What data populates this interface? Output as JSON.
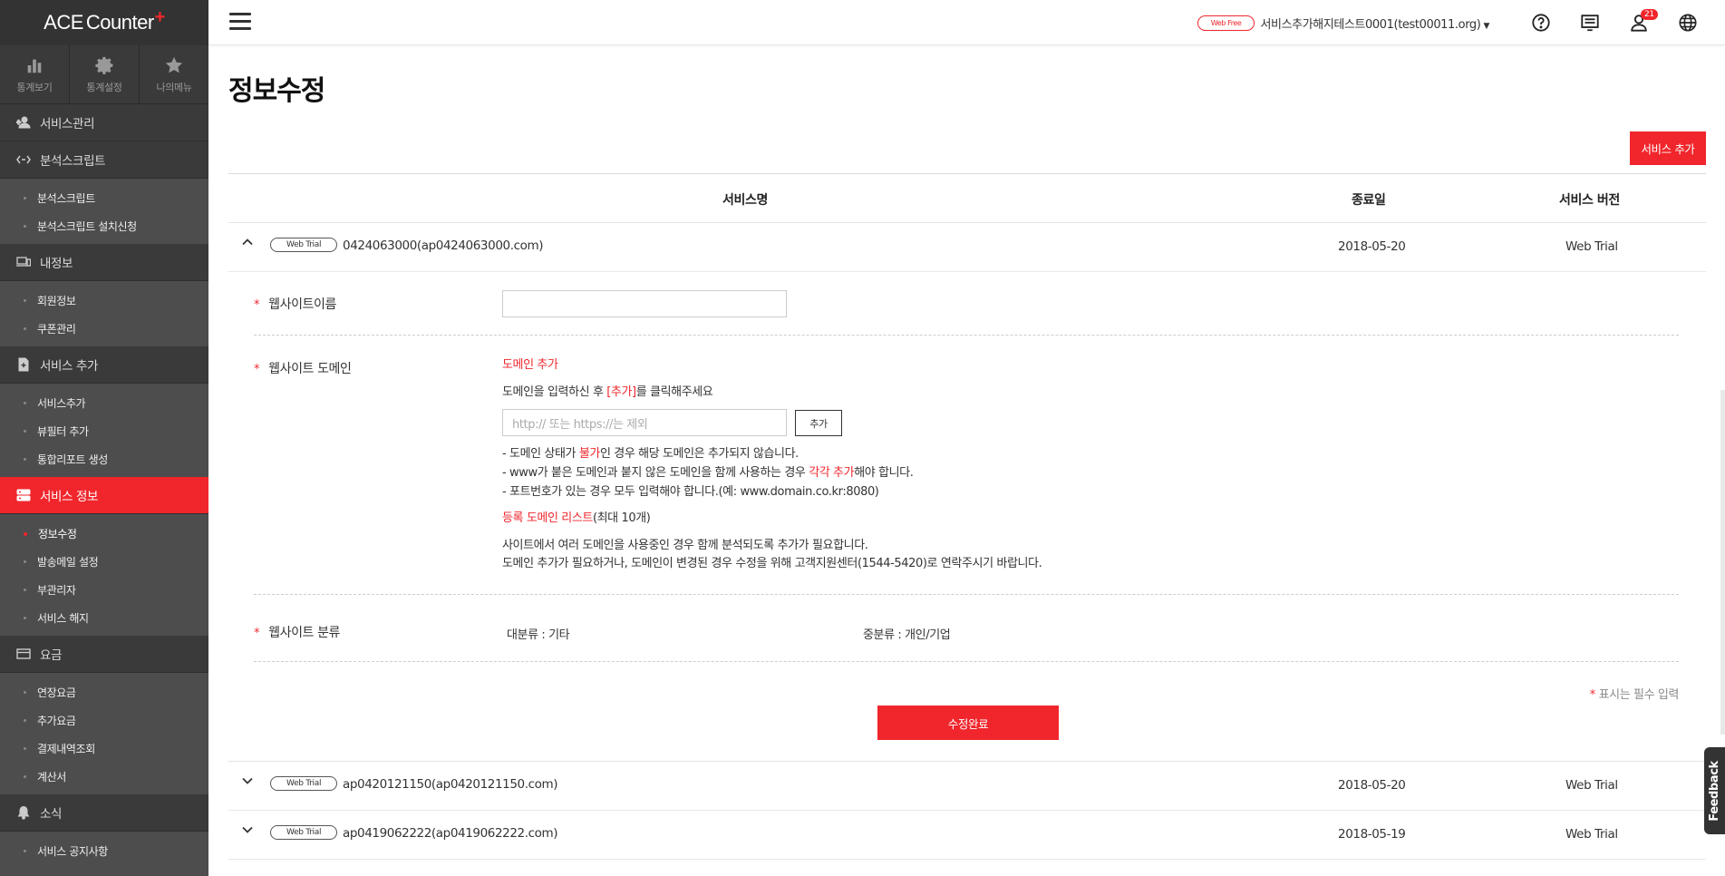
{
  "brand": {
    "logo_a": "ACE",
    "logo_b": "Counter",
    "logo_plus": "+"
  },
  "sidebar": {
    "top_icons": [
      {
        "label": "통계보기",
        "icon": "bar-chart-icon"
      },
      {
        "label": "통계설정",
        "icon": "gear-icon"
      },
      {
        "label": "나의메뉴",
        "icon": "star-icon"
      }
    ],
    "sections": [
      {
        "label": "서비스관리",
        "icon": "user-add-icon",
        "items": []
      },
      {
        "label": "분석스크립트",
        "icon": "code-arrows-icon",
        "items": [
          "분석스크립트",
          "분석스크립트 설치신청"
        ]
      },
      {
        "label": "내정보",
        "icon": "devices-icon",
        "items": [
          "회원정보",
          "쿠폰관리"
        ]
      },
      {
        "label": "서비스 추가",
        "icon": "file-add-icon",
        "items": [
          "서비스추가",
          "뷰필터 추가",
          "통합리포트 생성"
        ]
      },
      {
        "label": "서비스 정보",
        "icon": "server-icon",
        "active": true,
        "items": [
          "정보수정",
          "발송메일 설정",
          "부관리자",
          "서비스 해지"
        ]
      },
      {
        "label": "요금",
        "icon": "card-icon",
        "items": [
          "연장요금",
          "추가요금",
          "결제내역조회",
          "계산서"
        ]
      },
      {
        "label": "소식",
        "icon": "bell-icon",
        "items": [
          "서비스 공지사항"
        ]
      }
    ]
  },
  "header": {
    "plan_badge": "Web Free",
    "service_selector": "서비스추가해지테스트0001(test00011.org)",
    "notification_count": "21",
    "colors": {
      "accent": "#f0262c"
    }
  },
  "main": {
    "title": "정보수정",
    "add_service_button": "서비스 추가",
    "table": {
      "headers": {
        "name": "서비스명",
        "end_date": "종료일",
        "version": "서비스 버전"
      },
      "rows": [
        {
          "badge": "Web Trial",
          "name": "0424063000(ap0424063000.com)",
          "end_date": "2018-05-20",
          "version": "Web Trial",
          "expanded": true
        },
        {
          "badge": "Web Trial",
          "name": "ap0420121150(ap0420121150.com)",
          "end_date": "2018-05-20",
          "version": "Web Trial",
          "expanded": false
        },
        {
          "badge": "Web Trial",
          "name": "ap0419062222(ap0419062222.com)",
          "end_date": "2018-05-19",
          "version": "Web Trial",
          "expanded": false
        }
      ]
    },
    "form": {
      "required_mark": "*",
      "site_name_label": "웹사이트이름",
      "site_name_value": "",
      "domain_label": "웹사이트 도메인",
      "domain_add_title": "도메인 추가",
      "domain_instruction_pre": "도메인을 입력하신 후 ",
      "domain_instruction_red": "[추가]",
      "domain_instruction_post": "를 클릭해주세요",
      "domain_placeholder": "http:// 또는 https://는 제외",
      "domain_add_button": "추가",
      "note1_pre": "- 도메인 상태가 ",
      "note1_red": "불가",
      "note1_post": "인 경우 해당 도메인은 추가되지 않습니다.",
      "note2_pre": "- www가 붙은 도메인과 붙지 않은 도메인을 함께 사용하는 경우 ",
      "note2_red": "각각 추가",
      "note2_post": "해야 합니다.",
      "note3": "- 포트번호가 있는 경우 모두 입력해야 합니다.(예: www.domain.co.kr:8080)",
      "list_title_red": "등록 도메인 리스트",
      "list_title_post": "(최대 10개)",
      "list_desc1": "사이트에서 여러 도메인을 사용중인 경우 함께 분석되도록 추가가 필요합니다.",
      "list_desc2": "도메인 추가가 필요하거나, 도메인이 변경된 경우 수정을 위해 고객지원센터(1544-5420)로 연락주시기 바랍니다.",
      "category_label": "웹사이트 분류",
      "category_major": "대분류 : 기타",
      "category_minor": "중분류 : 개인/기업",
      "required_note": "표시는 필수 입력",
      "submit_button": "수정완료"
    }
  },
  "feedback_tab": "Feedback"
}
